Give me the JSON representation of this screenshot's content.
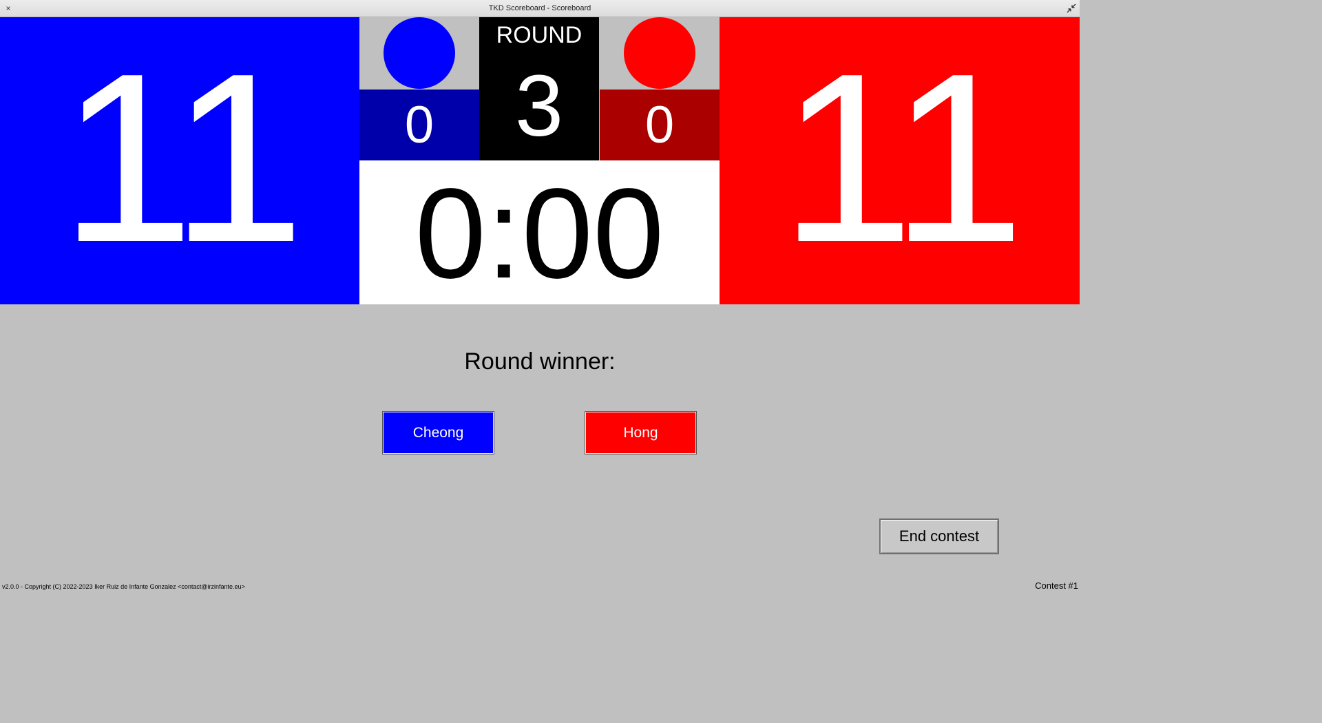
{
  "window": {
    "title": "TKD Scoreboard - Scoreboard",
    "close_glyph": "×"
  },
  "blue": {
    "color": "#0000ff",
    "dark_color": "#0000aa",
    "score": "11",
    "penalties": "0",
    "indicator_color": "#0000ff"
  },
  "red": {
    "color": "#ff0000",
    "dark_color": "#aa0000",
    "score": "11",
    "penalties": "0",
    "indicator_color": "#ff0000"
  },
  "round": {
    "label": "ROUND",
    "number": "3"
  },
  "timer": {
    "value": "0:00"
  },
  "winner": {
    "prompt": "Round winner:",
    "blue_button": "Cheong",
    "red_button": "Hong"
  },
  "actions": {
    "end_contest": "End contest"
  },
  "footer": {
    "copyright": "v2.0.0 - Copyright (C) 2022-2023 Iker Ruiz de Infante Gonzalez <contact@irzinfante.eu>",
    "contest": "Contest #1"
  },
  "icons": {
    "close": "close-icon",
    "restore": "restore-window-icon"
  }
}
